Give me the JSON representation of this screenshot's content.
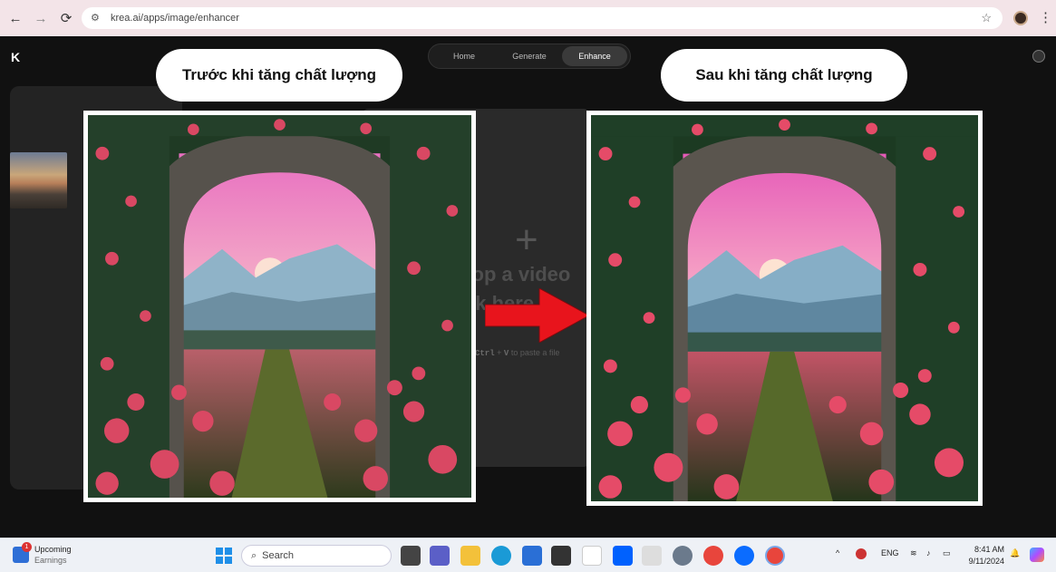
{
  "browser": {
    "url": "krea.ai/apps/image/enhancer",
    "nav_back": "←",
    "nav_forward": "→",
    "nav_reload": "⟳",
    "star": "☆",
    "menu": "⋮"
  },
  "app": {
    "logo": "K",
    "tabs": [
      {
        "label": "Home"
      },
      {
        "label": "Generate"
      },
      {
        "label": "Enhance"
      }
    ],
    "drop_zone": {
      "plus": "+",
      "line1": "rop a video",
      "line2": "ck here t",
      "hint_key1": "Ctrl",
      "hint_plus": "+",
      "hint_key2": "V",
      "hint_text": "to paste a file"
    }
  },
  "comparison": {
    "before_label": "Trước khi tăng chất lượng",
    "after_label": "Sau khi tăng chất lượng",
    "arrow_color": "#e8141c"
  },
  "taskbar": {
    "weather_title": "Upcoming",
    "weather_sub": "Earnings",
    "weather_badge": "1",
    "search_placeholder": "Search",
    "search_icon": "⌕",
    "language": "ENG",
    "tray_chevron": "^",
    "time": "8:41 AM",
    "date": "9/11/2024"
  }
}
